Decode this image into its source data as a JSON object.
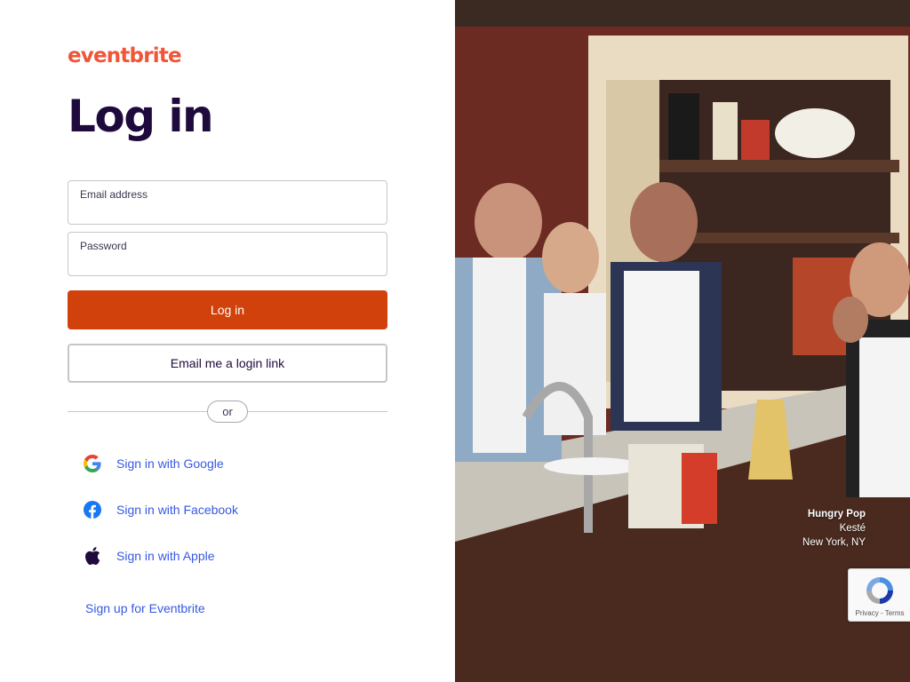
{
  "brand": {
    "logo_text": "eventbrite",
    "accent": "#f05537",
    "primary_button": "#d1410c",
    "link": "#3659e3",
    "heading": "#1e0a3c"
  },
  "page": {
    "title": "Log in"
  },
  "form": {
    "email": {
      "label": "Email address",
      "value": ""
    },
    "password": {
      "label": "Password",
      "value": ""
    },
    "login_button": "Log in",
    "email_link_button": "Email me a login link",
    "divider_text": "or"
  },
  "social": {
    "google": {
      "label": "Sign in with Google",
      "icon": "google-icon"
    },
    "facebook": {
      "label": "Sign in with Facebook",
      "icon": "facebook-icon"
    },
    "apple": {
      "label": "Sign in with Apple",
      "icon": "apple-icon"
    }
  },
  "signup_link": "Sign up for Eventbrite",
  "photo_caption": {
    "line1": "Hungry Pop",
    "line2": "Kesté",
    "line3": "New York, NY"
  },
  "recaptcha": {
    "text": "Privacy - Terms"
  }
}
